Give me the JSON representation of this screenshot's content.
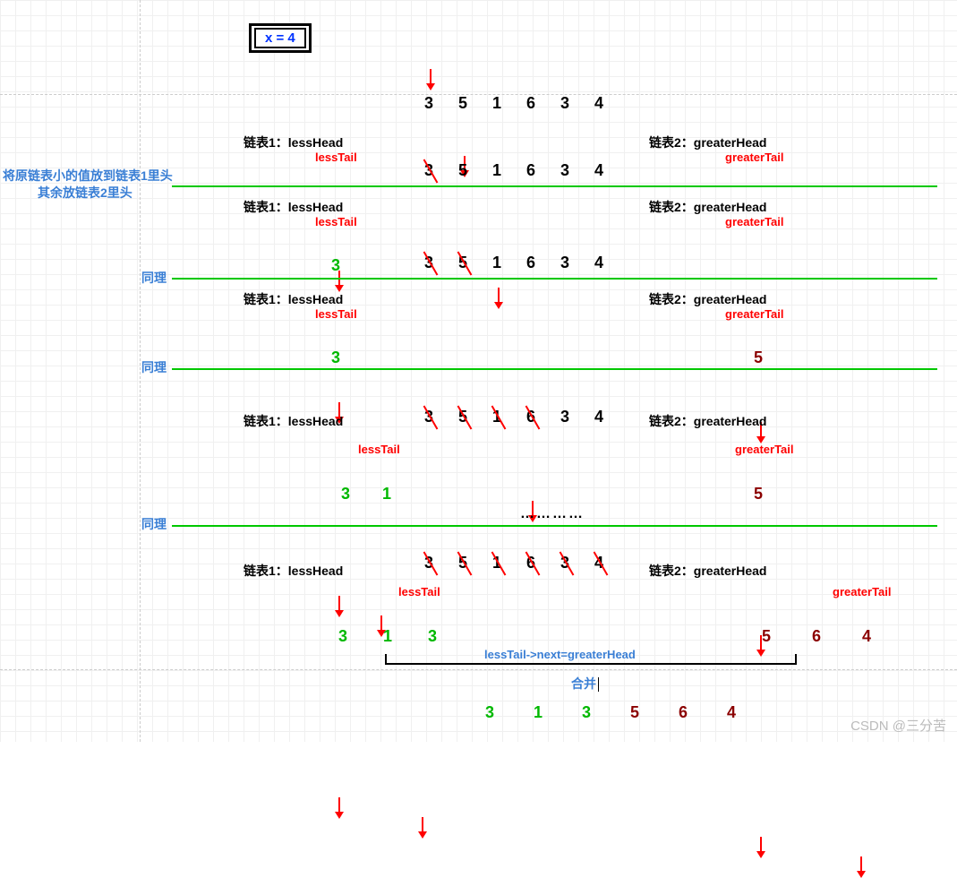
{
  "x_box": "x = 4",
  "original_sequence": [
    "3",
    "5",
    "1",
    "6",
    "3",
    "4"
  ],
  "note_line1": "将原链表小的值放到链表1里头",
  "note_line2": "其余放链表2里头",
  "list1_label": "链表1：lessHead",
  "list2_label": "链表2：greaterHead",
  "lesstail_label": "lessTail",
  "greatertail_label": "greaterTail",
  "same_label": "同理",
  "dots": "…………",
  "merge_expr": "lessTail->next=greaterHead",
  "merge_label": "合并",
  "final_less": [
    "3",
    "1",
    "3"
  ],
  "final_greater": [
    "5",
    "6",
    "4"
  ],
  "step2_less": [
    "3"
  ],
  "step3_less": [
    "3"
  ],
  "step3_greater": [
    "5"
  ],
  "step4_less": [
    "3",
    "1"
  ],
  "step4_greater": [
    "5"
  ],
  "step5_less": [
    "3",
    "1",
    "3"
  ],
  "step5_greater": [
    "5",
    "6",
    "4"
  ],
  "merged": [
    "3",
    "1",
    "3",
    "5",
    "6",
    "4"
  ],
  "watermark": "CSDN @三分苦"
}
